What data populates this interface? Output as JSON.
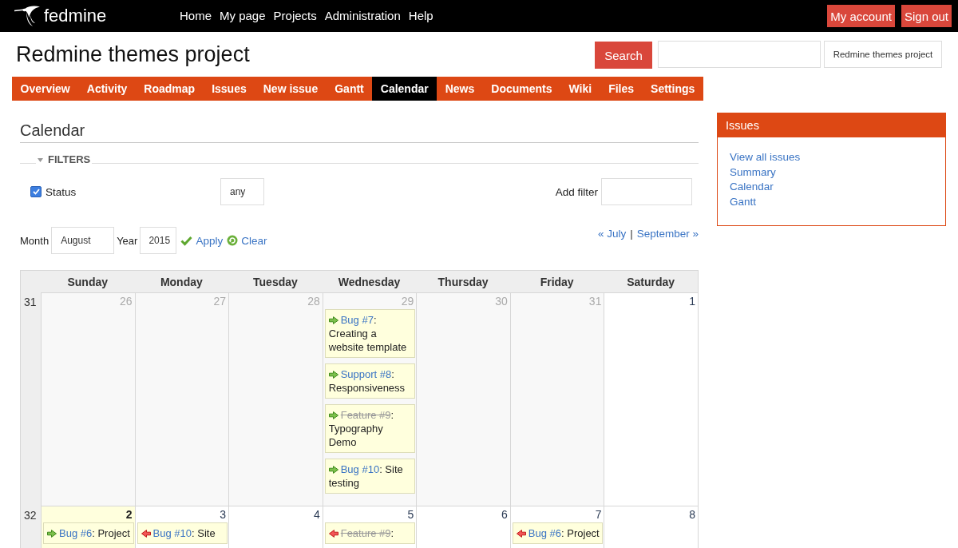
{
  "top_menu": {
    "logo": "fedmine",
    "items": [
      "Home",
      "My page",
      "Projects",
      "Administration",
      "Help"
    ],
    "account": [
      "My account",
      "Sign out"
    ]
  },
  "header": {
    "title": "Redmine themes project",
    "search_button": "Search",
    "project_jump": "Redmine themes project"
  },
  "tabs": [
    {
      "label": "Overview",
      "selected": false
    },
    {
      "label": "Activity",
      "selected": false
    },
    {
      "label": "Roadmap",
      "selected": false
    },
    {
      "label": "Issues",
      "selected": false
    },
    {
      "label": "New issue",
      "selected": false
    },
    {
      "label": "Gantt",
      "selected": false
    },
    {
      "label": "Calendar",
      "selected": true
    },
    {
      "label": "News",
      "selected": false
    },
    {
      "label": "Documents",
      "selected": false
    },
    {
      "label": "Wiki",
      "selected": false
    },
    {
      "label": "Files",
      "selected": false
    },
    {
      "label": "Settings",
      "selected": false
    }
  ],
  "main": {
    "title": "Calendar",
    "filters": {
      "legend": "FILTERS",
      "expanded": true,
      "rows": [
        {
          "label": "Status",
          "checked": true,
          "operator": "any"
        }
      ],
      "add_filter": "Add filter"
    },
    "period": {
      "month_label": "Month",
      "month": "August",
      "year_label": "Year",
      "year": "2015",
      "apply": "Apply",
      "clear": "Clear"
    },
    "month_nav": {
      "previous": "« July",
      "separator": "|",
      "next": "September »"
    },
    "calendar": {
      "columns": [
        "Sunday",
        "Monday",
        "Tuesday",
        "Wednesday",
        "Thursday",
        "Friday",
        "Saturday"
      ],
      "weeks": [
        {
          "number": "31",
          "days": [
            {
              "day": "26",
              "other_month": true,
              "today": false
            },
            {
              "day": "27",
              "other_month": true,
              "today": false
            },
            {
              "day": "28",
              "other_month": true,
              "today": false
            },
            {
              "day": "29",
              "other_month": true,
              "today": false,
              "issues": [
                {
                  "kind": "start",
                  "link": "Bug #7",
                  "closed": false,
                  "rest": ": Creating a website template"
                },
                {
                  "kind": "start",
                  "link": "Support #8",
                  "closed": false,
                  "rest": ": Responsiveness"
                },
                {
                  "kind": "start",
                  "link": "Feature #9",
                  "closed": true,
                  "rest": ": Typography Demo"
                },
                {
                  "kind": "start",
                  "link": "Bug #10",
                  "closed": false,
                  "rest": ": Site testing"
                }
              ]
            },
            {
              "day": "30",
              "other_month": true,
              "today": false
            },
            {
              "day": "31",
              "other_month": true,
              "today": false
            },
            {
              "day": "1",
              "other_month": false,
              "today": false
            }
          ]
        },
        {
          "number": "32",
          "days": [
            {
              "day": "2",
              "other_month": false,
              "today": true,
              "issues": [
                {
                  "kind": "start",
                  "link": "Bug #6",
                  "closed": false,
                  "rest": ": Project"
                }
              ]
            },
            {
              "day": "3",
              "other_month": false,
              "today": false,
              "issues": [
                {
                  "kind": "end",
                  "link": "Bug #10",
                  "closed": false,
                  "rest": ": Site"
                }
              ]
            },
            {
              "day": "4",
              "other_month": false,
              "today": false
            },
            {
              "day": "5",
              "other_month": false,
              "today": false,
              "issues": [
                {
                  "kind": "end",
                  "link": "Feature #9",
                  "closed": true,
                  "rest": ":"
                }
              ]
            },
            {
              "day": "6",
              "other_month": false,
              "today": false
            },
            {
              "day": "7",
              "other_month": false,
              "today": false,
              "issues": [
                {
                  "kind": "end",
                  "link": "Bug #6",
                  "closed": false,
                  "rest": ": Project"
                }
              ]
            },
            {
              "day": "8",
              "other_month": false,
              "today": false
            }
          ]
        }
      ]
    }
  },
  "sidebar": {
    "title": "Issues",
    "links": [
      "View all issues",
      "Summary",
      "Calendar",
      "Gantt"
    ]
  }
}
